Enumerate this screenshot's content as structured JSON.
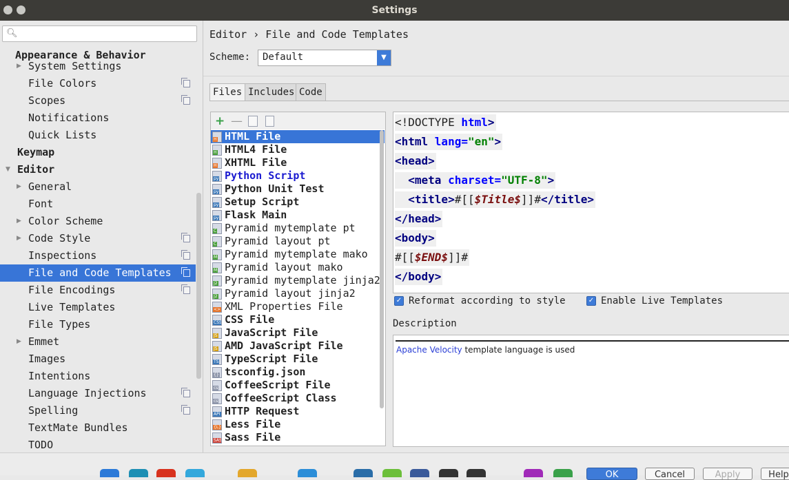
{
  "window": {
    "title": "Settings"
  },
  "search": {
    "placeholder": ""
  },
  "sidebar": {
    "items": [
      {
        "label": "Appearance & Behavior",
        "level": 0,
        "bold": true
      },
      {
        "label": "System Settings",
        "level": 1,
        "expandable": true
      },
      {
        "label": "File Colors",
        "level": 1,
        "project_icon": true
      },
      {
        "label": "Scopes",
        "level": 1,
        "project_icon": true
      },
      {
        "label": "Notifications",
        "level": 1
      },
      {
        "label": "Quick Lists",
        "level": 1
      },
      {
        "label": "Keymap",
        "level": 0,
        "bold": true
      },
      {
        "label": "Editor",
        "level": 0,
        "bold": true,
        "expanded": true
      },
      {
        "label": "General",
        "level": 1,
        "expandable": true
      },
      {
        "label": "Font",
        "level": 1
      },
      {
        "label": "Color Scheme",
        "level": 1,
        "expandable": true
      },
      {
        "label": "Code Style",
        "level": 1,
        "expandable": true,
        "project_icon": true
      },
      {
        "label": "Inspections",
        "level": 1,
        "project_icon": true
      },
      {
        "label": "File and Code Templates",
        "level": 1,
        "project_icon": true,
        "selected": true
      },
      {
        "label": "File Encodings",
        "level": 1,
        "project_icon": true
      },
      {
        "label": "Live Templates",
        "level": 1
      },
      {
        "label": "File Types",
        "level": 1
      },
      {
        "label": "Emmet",
        "level": 1,
        "expandable": true
      },
      {
        "label": "Images",
        "level": 1
      },
      {
        "label": "Intentions",
        "level": 1
      },
      {
        "label": "Language Injections",
        "level": 1,
        "project_icon": true
      },
      {
        "label": "Spelling",
        "level": 1,
        "project_icon": true
      },
      {
        "label": "TextMate Bundles",
        "level": 1
      },
      {
        "label": "TODO",
        "level": 1
      }
    ]
  },
  "breadcrumb": {
    "parent": "Editor",
    "separator": "›",
    "current": "File and Code Templates"
  },
  "scheme": {
    "label": "Scheme:",
    "value": "Default"
  },
  "tabs": [
    {
      "label": "Files",
      "active": true
    },
    {
      "label": "Includes",
      "active": false
    },
    {
      "label": "Code",
      "active": false
    }
  ],
  "toolbar": {
    "add": "+",
    "remove": "—"
  },
  "templates": [
    {
      "label": "HTML File",
      "icon": "H",
      "icon_color": "#e8772e",
      "style": "bold",
      "selected": true
    },
    {
      "label": "HTML4 File",
      "icon": "H",
      "icon_color": "#4a9f3a",
      "style": "bold"
    },
    {
      "label": "XHTML File",
      "icon": "H",
      "icon_color": "#e8772e",
      "style": "bold"
    },
    {
      "label": "Python Script",
      "icon": "py",
      "icon_color": "#3b78b8",
      "style": "blue"
    },
    {
      "label": "Python Unit Test",
      "icon": "py",
      "icon_color": "#3b78b8",
      "style": "bold"
    },
    {
      "label": "Setup Script",
      "icon": "py",
      "icon_color": "#3b78b8",
      "style": "bold"
    },
    {
      "label": "Flask Main",
      "icon": "py",
      "icon_color": "#3b78b8",
      "style": "bold"
    },
    {
      "label": "Pyramid mytemplate pt",
      "icon": "C",
      "icon_color": "#4a9f3a",
      "style": "normal"
    },
    {
      "label": "Pyramid layout pt",
      "icon": "C",
      "icon_color": "#4a9f3a",
      "style": "normal"
    },
    {
      "label": "Pyramid mytemplate mako",
      "icon": "M",
      "icon_color": "#4a9f3a",
      "style": "normal"
    },
    {
      "label": "Pyramid layout mako",
      "icon": "M",
      "icon_color": "#4a9f3a",
      "style": "normal"
    },
    {
      "label": "Pyramid mytemplate jinja2",
      "icon": "J2",
      "icon_color": "#4a9f3a",
      "style": "normal"
    },
    {
      "label": "Pyramid layout jinja2",
      "icon": "J2",
      "icon_color": "#4a9f3a",
      "style": "normal"
    },
    {
      "label": "XML Properties File",
      "icon": "<>",
      "icon_color": "#e8772e",
      "style": "normal"
    },
    {
      "label": "CSS File",
      "icon": "CSS",
      "icon_color": "#3b78b8",
      "style": "bold"
    },
    {
      "label": "JavaScript File",
      "icon": "JS",
      "icon_color": "#d4a017",
      "style": "bold"
    },
    {
      "label": "AMD JavaScript File",
      "icon": "JS",
      "icon_color": "#d4a017",
      "style": "bold"
    },
    {
      "label": "TypeScript File",
      "icon": "TS",
      "icon_color": "#3b78b8",
      "style": "bold"
    },
    {
      "label": "tsconfig.json",
      "icon": "{}",
      "icon_color": "#8f97ab",
      "style": "bold"
    },
    {
      "label": "CoffeeScript File",
      "icon": "cs",
      "icon_color": "#8f97ab",
      "style": "bold"
    },
    {
      "label": "CoffeeScript Class",
      "icon": "cs",
      "icon_color": "#8f97ab",
      "style": "bold"
    },
    {
      "label": "HTTP Request",
      "icon": "API",
      "icon_color": "#3b78b8",
      "style": "bold"
    },
    {
      "label": "Less File",
      "icon": "{L}",
      "icon_color": "#e8772e",
      "style": "bold"
    },
    {
      "label": "Sass File",
      "icon": "SASS",
      "icon_color": "#d0453a",
      "style": "bold"
    }
  ],
  "editor": {
    "lines": [
      [
        {
          "t": "<!DOCTYPE ",
          "c": "plain"
        },
        {
          "t": "html",
          "c": "attr"
        },
        {
          "t": ">",
          "c": "tag"
        }
      ],
      [
        {
          "t": "<html ",
          "c": "tag"
        },
        {
          "t": "lang=",
          "c": "attr"
        },
        {
          "t": "\"en\"",
          "c": "str"
        },
        {
          "t": ">",
          "c": "tag"
        }
      ],
      [
        {
          "t": "<head>",
          "c": "tag"
        }
      ],
      [
        {
          "t": "  ",
          "c": "plain"
        },
        {
          "t": "<meta ",
          "c": "tag"
        },
        {
          "t": "charset=",
          "c": "attr"
        },
        {
          "t": "\"UTF-8\"",
          "c": "str"
        },
        {
          "t": ">",
          "c": "tag"
        }
      ],
      [
        {
          "t": "  ",
          "c": "plain"
        },
        {
          "t": "<title>",
          "c": "tag"
        },
        {
          "t": "#[[",
          "c": "plain"
        },
        {
          "t": "$Title$",
          "c": "var"
        },
        {
          "t": "]]#",
          "c": "plain"
        },
        {
          "t": "</title>",
          "c": "tag"
        }
      ],
      [
        {
          "t": "</head>",
          "c": "tag"
        }
      ],
      [
        {
          "t": "<body>",
          "c": "tag"
        }
      ],
      [
        {
          "t": "#[[",
          "c": "plain"
        },
        {
          "t": "$END$",
          "c": "var"
        },
        {
          "t": "]]#",
          "c": "plain"
        }
      ],
      [
        {
          "t": "</body>",
          "c": "tag"
        }
      ]
    ]
  },
  "options": {
    "reformat": {
      "label": "Reformat according to style",
      "checked": true
    },
    "live_templates": {
      "label": "Enable Live Templates",
      "checked": true
    }
  },
  "description": {
    "label": "Description",
    "link_text": "Apache Velocity",
    "text": " template language is used"
  },
  "buttons": {
    "ok": "OK",
    "cancel": "Cancel",
    "apply": "Apply",
    "help": "Help"
  }
}
